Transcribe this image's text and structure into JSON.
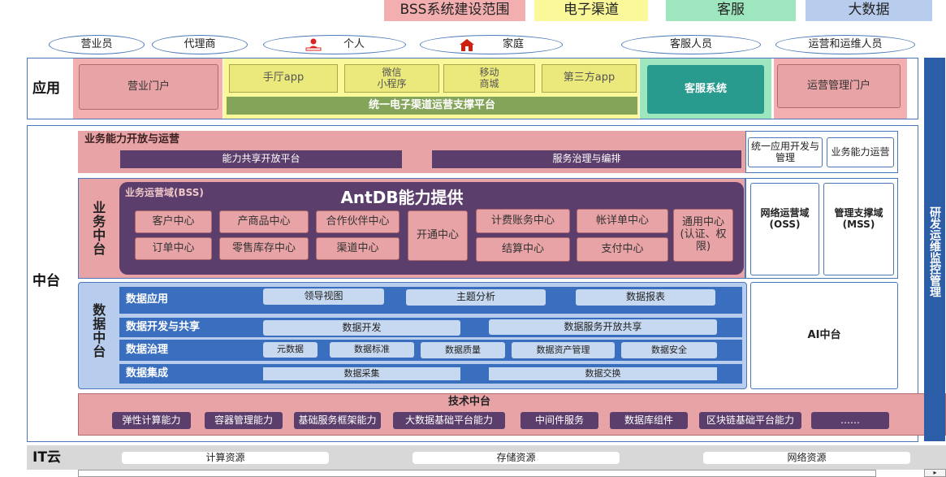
{
  "legend": [
    {
      "label": "BSS系统建设范围",
      "color": "#f3aeb0"
    },
    {
      "label": "电子渠道",
      "color": "#fbf899"
    },
    {
      "label": "客服",
      "color": "#9ee6bd"
    },
    {
      "label": "大数据",
      "color": "#b8cdee"
    }
  ],
  "users": [
    "营业员",
    "代理商",
    "个人",
    "家庭",
    "客服人员",
    "运营和运维人员"
  ],
  "app": {
    "label": "应用",
    "portal": "营业门户",
    "channels": [
      "手厅app",
      "微信\n小程序",
      "移动\n商城",
      "第三方app"
    ],
    "unified": "统一电子渠道运营支撑平台",
    "customer_service": "客服系统",
    "ops_portal": "运营管理门户"
  },
  "middle": {
    "label": "中台",
    "capability": {
      "title": "业务能力开放与运营",
      "platforms": [
        "能力共享开放平台",
        "服务治理与编排"
      ],
      "side": [
        "统一应用开发与管理",
        "业务能力运营"
      ]
    },
    "business": {
      "label": "业务中台",
      "domain": "业务运营域(BSS)",
      "overlay": "AntDB能力提供",
      "row1": [
        "客户中心",
        "产商品中心",
        "合作伙伴中心"
      ],
      "row2": [
        "订单中心",
        "零售库存中心",
        "渠道中心"
      ],
      "activation": "开通中心",
      "billing_row1": [
        "计费账务中心",
        "帐详单中心"
      ],
      "billing_row2": [
        "结算中心",
        "支付中心"
      ],
      "general": "通用中心\n(认证、权\n限)",
      "oss": "网络运营域\n(OSS)",
      "mss": "管理支撑域\n(MSS)"
    },
    "data": {
      "label": "数据中台",
      "rows": [
        {
          "name": "数据应用",
          "items": [
            "领导视图",
            "主题分析",
            "数据报表"
          ]
        },
        {
          "name": "数据开发与共享",
          "items": [
            "数据开发",
            "数据服务开放共享"
          ]
        },
        {
          "name": "数据治理",
          "items": [
            "元数据",
            "数据标准",
            "数据质量",
            "数据资产管理",
            "数据安全"
          ]
        },
        {
          "name": "数据集成",
          "items": [
            "数据采集",
            "数据交换"
          ]
        }
      ],
      "ai": "AI中台"
    },
    "tech": {
      "title": "技术中台",
      "items": [
        "弹性计算能力",
        "容器管理能力",
        "基础服务框架能力",
        "大数据基础平台能力",
        "中间件服务",
        "数据库组件",
        "区块链基础平台能力",
        "……"
      ]
    }
  },
  "side_bar": "研发运维监控管理",
  "it_cloud": {
    "label": "IT云",
    "resources": [
      "计算资源",
      "存储资源",
      "网络资源"
    ]
  }
}
